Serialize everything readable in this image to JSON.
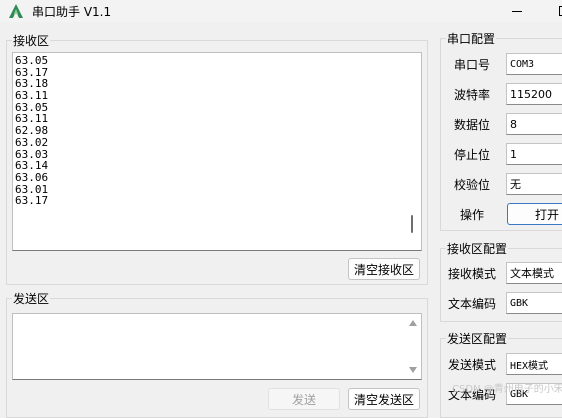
{
  "window": {
    "title": "串口助手 V1.1"
  },
  "receive": {
    "group_title": "接收区",
    "lines": [
      "63.05",
      "63.17",
      "63.18",
      "63.11",
      "63.05",
      "63.11",
      "62.98",
      "63.02",
      "63.03",
      "63.14",
      "63.06",
      "63.01",
      "63.17"
    ],
    "clear_label": "清空接收区"
  },
  "send": {
    "group_title": "发送区",
    "send_label": "发送",
    "clear_label": "清空发送区"
  },
  "serial_config": {
    "group_title": "串口配置",
    "port_label": "串口号",
    "port_value": "COM3",
    "baud_label": "波特率",
    "baud_value": "115200",
    "databits_label": "数据位",
    "databits_value": "8",
    "stopbits_label": "停止位",
    "stopbits_value": "1",
    "parity_label": "校验位",
    "parity_value": "无",
    "operation_label": "操作",
    "open_label": "打开"
  },
  "rx_config": {
    "group_title": "接收区配置",
    "mode_label": "接收模式",
    "mode_value": "文本模式",
    "encoding_label": "文本编码",
    "encoding_value": "GBK"
  },
  "tx_config": {
    "group_title": "发送区配置",
    "mode_label": "发送模式",
    "mode_value": "HEX模式",
    "encoding_label": "文本编码",
    "encoding_value": "GBK"
  },
  "watermark": "CSDN @青州电子的小宋",
  "colors": {
    "logo": "#2e8b57",
    "accent": "#3b79c7"
  }
}
